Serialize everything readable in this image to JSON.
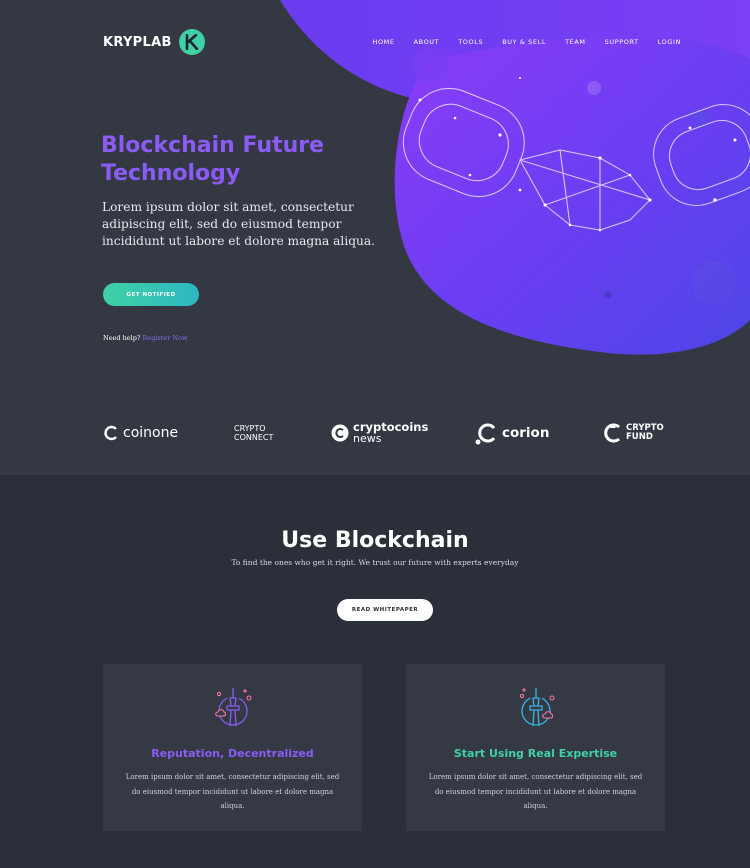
{
  "header": {
    "brand": "KRYPLAB",
    "badge_letter": "K",
    "nav": [
      "HOME",
      "ABOUT",
      "TOOLS",
      "BUY & SELL",
      "TEAM",
      "SUPPORT",
      "LOGIN"
    ]
  },
  "hero": {
    "title": "Blockchain Future Technology",
    "text": "Lorem ipsum dolor sit amet, consectetur adipiscing elit, sed do eiusmod tempor incididunt ut labore et dolore magna aliqua.",
    "cta": "GET NOTIFIED",
    "help_text": "Need help?",
    "help_link": "Register Now"
  },
  "partners": {
    "coinone": "coinone",
    "crypto_connect": [
      "CRYPTO",
      "CONNECT"
    ],
    "cryptocoins_news": [
      "cryptocoins",
      "news"
    ],
    "corion": "corion",
    "crypto_fund": [
      "CRYPTO",
      "FUND"
    ]
  },
  "section": {
    "title": "Use Blockchain",
    "subtitle": "To find the ones who get it right. We trust our future with experts everyday",
    "cta": "READ WHITEPAPER"
  },
  "cards": [
    {
      "title": "Reputation, Decentralized",
      "text": "Lorem ipsum dolor sit amet, consectetur adipiscing elit, sed do eiusmod tempor incididunt ut labore et dolore magna aliqua.",
      "icon": "tower-icon"
    },
    {
      "title": "Start Using Real Expertise",
      "text": "Lorem ipsum dolor sit amet, consectetur adipiscing elit, sed do eiusmod tempor incididunt ut labore et dolore magna aliqua.",
      "icon": "tower-icon"
    }
  ],
  "colors": {
    "accent_purple": "#8a5cf5",
    "accent_teal": "#3fd1a4",
    "background": "#2b2f39",
    "hero_background": "#343843",
    "card_background": "#353944"
  }
}
